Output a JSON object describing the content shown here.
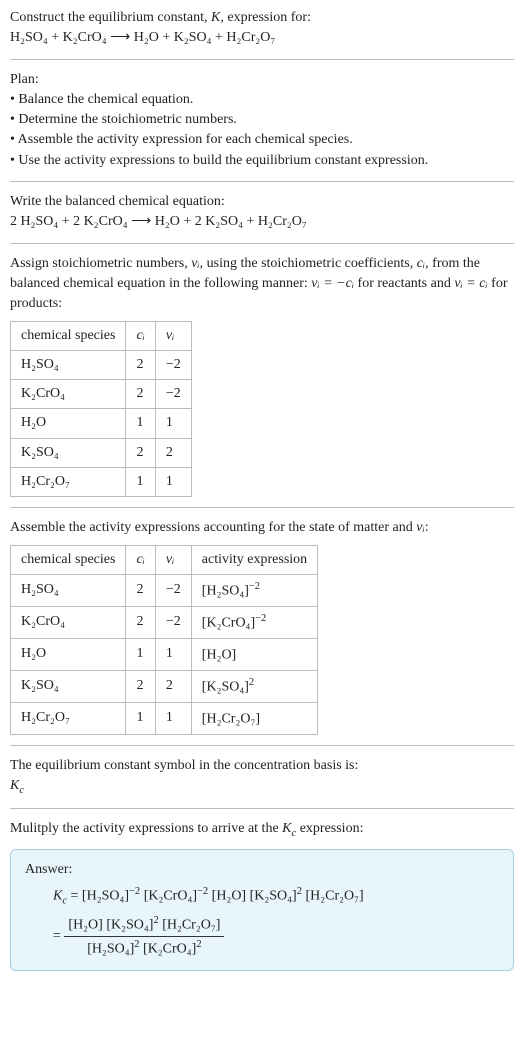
{
  "intro": {
    "line1_a": "Construct the equilibrium constant, ",
    "K": "K",
    "line1_b": ", expression for:",
    "equation_unbalanced": "H₂SO₄ + K₂CrO₄ ⟶ H₂O + K₂SO₄ + H₂Cr₂O₇"
  },
  "plan": {
    "heading": "Plan:",
    "b1": "• Balance the chemical equation.",
    "b2": "• Determine the stoichiometric numbers.",
    "b3": "• Assemble the activity expression for each chemical species.",
    "b4": "• Use the activity expressions to build the equilibrium constant expression."
  },
  "balanced": {
    "heading": "Write the balanced chemical equation:",
    "equation": "2 H₂SO₄ + 2 K₂CrO₄ ⟶ H₂O + 2 K₂SO₄ + H₂Cr₂O₇"
  },
  "assign": {
    "text_a": "Assign stoichiometric numbers, ",
    "nu_i": "νᵢ",
    "text_b": ", using the stoichiometric coefficients, ",
    "c_i": "cᵢ",
    "text_c": ", from the balanced chemical equation in the following manner: ",
    "rel1": "νᵢ = −cᵢ",
    "text_d": " for reactants and ",
    "rel2": "νᵢ = cᵢ",
    "text_e": " for products:"
  },
  "table1": {
    "h1": "chemical species",
    "h2": "cᵢ",
    "h3": "νᵢ",
    "rows": [
      {
        "sp": "H₂SO₄",
        "c": "2",
        "n": "−2"
      },
      {
        "sp": "K₂CrO₄",
        "c": "2",
        "n": "−2"
      },
      {
        "sp": "H₂O",
        "c": "1",
        "n": "1"
      },
      {
        "sp": "K₂SO₄",
        "c": "2",
        "n": "2"
      },
      {
        "sp": "H₂Cr₂O₇",
        "c": "1",
        "n": "1"
      }
    ]
  },
  "assemble": {
    "text_a": "Assemble the activity expressions accounting for the state of matter and ",
    "nu_i": "νᵢ",
    "text_b": ":"
  },
  "table2": {
    "h1": "chemical species",
    "h2": "cᵢ",
    "h3": "νᵢ",
    "h4": "activity expression",
    "rows": [
      {
        "sp": "H₂SO₄",
        "c": "2",
        "n": "−2",
        "a_base": "[H₂SO₄]",
        "a_exp": "−2"
      },
      {
        "sp": "K₂CrO₄",
        "c": "2",
        "n": "−2",
        "a_base": "[K₂CrO₄]",
        "a_exp": "−2"
      },
      {
        "sp": "H₂O",
        "c": "1",
        "n": "1",
        "a_base": "[H₂O]",
        "a_exp": ""
      },
      {
        "sp": "K₂SO₄",
        "c": "2",
        "n": "2",
        "a_base": "[K₂SO₄]",
        "a_exp": "2"
      },
      {
        "sp": "H₂Cr₂O₇",
        "c": "1",
        "n": "1",
        "a_base": "[H₂Cr₂O₇]",
        "a_exp": ""
      }
    ]
  },
  "symbol": {
    "line1": "The equilibrium constant symbol in the concentration basis is:",
    "Kc": "K",
    "Kc_sub": "c"
  },
  "multiply": {
    "text_a": "Mulitply the activity expressions to arrive at the ",
    "Kc": "K",
    "Kc_sub": "c",
    "text_b": " expression:"
  },
  "answer": {
    "label": "Answer:",
    "Kc": "K",
    "Kc_sub": "c",
    "eq": " = ",
    "line1_t1": "[H₂SO₄]",
    "line1_e1": "−2",
    "line1_t2": " [K₂CrO₄]",
    "line1_e2": "−2",
    "line1_t3": " [H₂O] [K₂SO₄]",
    "line1_e3": "2",
    "line1_t4": " [H₂Cr₂O₇]",
    "eq2": "= ",
    "num_t1": "[H₂O] [K₂SO₄]",
    "num_e1": "2",
    "num_t2": " [H₂Cr₂O₇]",
    "den_t1": "[H₂SO₄]",
    "den_e1": "2",
    "den_t2": " [K₂CrO₄]",
    "den_e2": "2"
  },
  "chart_data": {
    "type": "table",
    "tables": [
      {
        "title": "Stoichiometric numbers",
        "columns": [
          "chemical species",
          "c_i",
          "ν_i"
        ],
        "rows": [
          [
            "H2SO4",
            2,
            -2
          ],
          [
            "K2CrO4",
            2,
            -2
          ],
          [
            "H2O",
            1,
            1
          ],
          [
            "K2SO4",
            2,
            2
          ],
          [
            "H2Cr2O7",
            1,
            1
          ]
        ]
      },
      {
        "title": "Activity expressions",
        "columns": [
          "chemical species",
          "c_i",
          "ν_i",
          "activity expression"
        ],
        "rows": [
          [
            "H2SO4",
            2,
            -2,
            "[H2SO4]^-2"
          ],
          [
            "K2CrO4",
            2,
            -2,
            "[K2CrO4]^-2"
          ],
          [
            "H2O",
            1,
            1,
            "[H2O]"
          ],
          [
            "K2SO4",
            2,
            2,
            "[K2SO4]^2"
          ],
          [
            "H2Cr2O7",
            1,
            1,
            "[H2Cr2O7]"
          ]
        ]
      }
    ],
    "equations": {
      "unbalanced": "H2SO4 + K2CrO4 -> H2O + K2SO4 + H2Cr2O7",
      "balanced": "2 H2SO4 + 2 K2CrO4 -> H2O + 2 K2SO4 + H2Cr2O7",
      "Kc": "Kc = ([H2O][K2SO4]^2[H2Cr2O7]) / ([H2SO4]^2[K2CrO4]^2)"
    }
  }
}
